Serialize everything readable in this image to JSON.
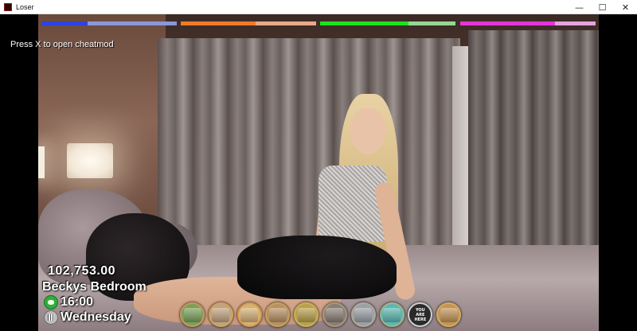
{
  "window": {
    "title": "Loser",
    "controls": {
      "minimize": "—",
      "maximize": "☐",
      "close": "✕"
    }
  },
  "status_bars": [
    {
      "name": "bar-blue",
      "fill": 0.34,
      "fill_color": "#2f43e0",
      "track_color": "#8a97d8"
    },
    {
      "name": "bar-orange",
      "fill": 0.55,
      "fill_color": "#f07a2a",
      "track_color": "#e7a98a"
    },
    {
      "name": "bar-green",
      "fill": 0.65,
      "fill_color": "#1fe11f",
      "track_color": "#94d894"
    },
    {
      "name": "bar-magenta",
      "fill": 0.7,
      "fill_color": "#e436d8",
      "track_color": "#e2a4de"
    }
  ],
  "cheat_hint": "Press X to open cheatmod",
  "hud": {
    "money": "102,753.00",
    "location": "Beckys Bedroom",
    "time": "16:00",
    "day": "Wednesday",
    "time_icon": "clock-icon",
    "day_icon": "calendar-icon"
  },
  "nav_buttons": [
    {
      "name": "nav-outside",
      "color": "#7aa05a",
      "border": "#c49a5a"
    },
    {
      "name": "nav-hallway",
      "color": "#c2a27e",
      "border": "#d0a45c"
    },
    {
      "name": "nav-kitchen",
      "color": "#d6b074",
      "border": "#d79a4a"
    },
    {
      "name": "nav-livingroom",
      "color": "#b89062",
      "border": "#c4a25e"
    },
    {
      "name": "nav-town",
      "color": "#b9a04a",
      "border": "#c8b25a"
    },
    {
      "name": "nav-bedroom",
      "color": "#8a7e74",
      "border": "#a69a7a"
    },
    {
      "name": "nav-character",
      "color": "#9aa0a6",
      "border": "#b2a89a"
    },
    {
      "name": "nav-shop",
      "color": "#5ab8b0",
      "border": "#a6b28a"
    },
    {
      "name": "nav-you-are-here",
      "color": "#2a2a2a",
      "border": "#cfcfcf",
      "label_1": "YOU",
      "label_2": "ARE",
      "label_3": "HERE"
    },
    {
      "name": "nav-door",
      "color": "#c39456",
      "border": "#d6aa5e"
    }
  ]
}
